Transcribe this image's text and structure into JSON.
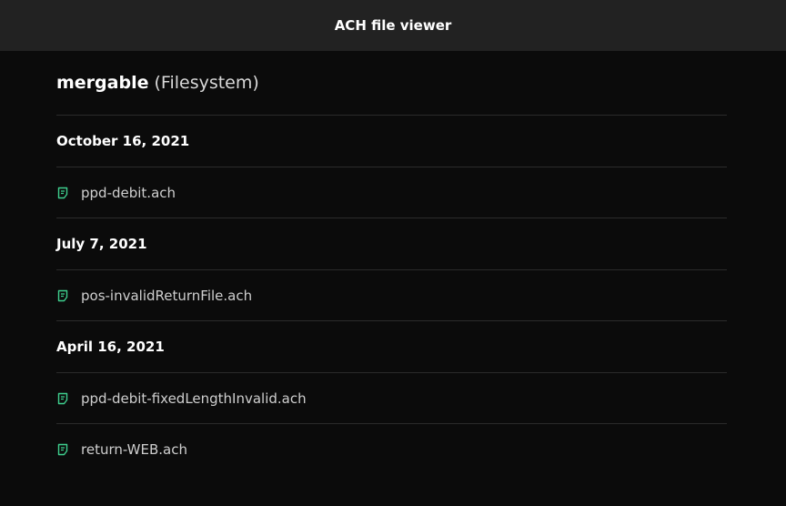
{
  "app": {
    "title": "ACH file viewer"
  },
  "section": {
    "name": "mergable",
    "source": "(Filesystem)"
  },
  "groups": [
    {
      "date": "October 16, 2021",
      "files": [
        {
          "name": "ppd-debit.ach",
          "icon": "file-icon"
        }
      ]
    },
    {
      "date": "July 7, 2021",
      "files": [
        {
          "name": "pos-invalidReturnFile.ach",
          "icon": "file-icon"
        }
      ]
    },
    {
      "date": "April 16, 2021",
      "files": [
        {
          "name": "ppd-debit-fixedLengthInvalid.ach",
          "icon": "file-icon"
        },
        {
          "name": "return-WEB.ach",
          "icon": "file-icon"
        }
      ]
    }
  ],
  "colors": {
    "background": "#0b0b0b",
    "header": "#222222",
    "icon_accent": "#3ecf8e",
    "divider": "#2b2b2b"
  }
}
